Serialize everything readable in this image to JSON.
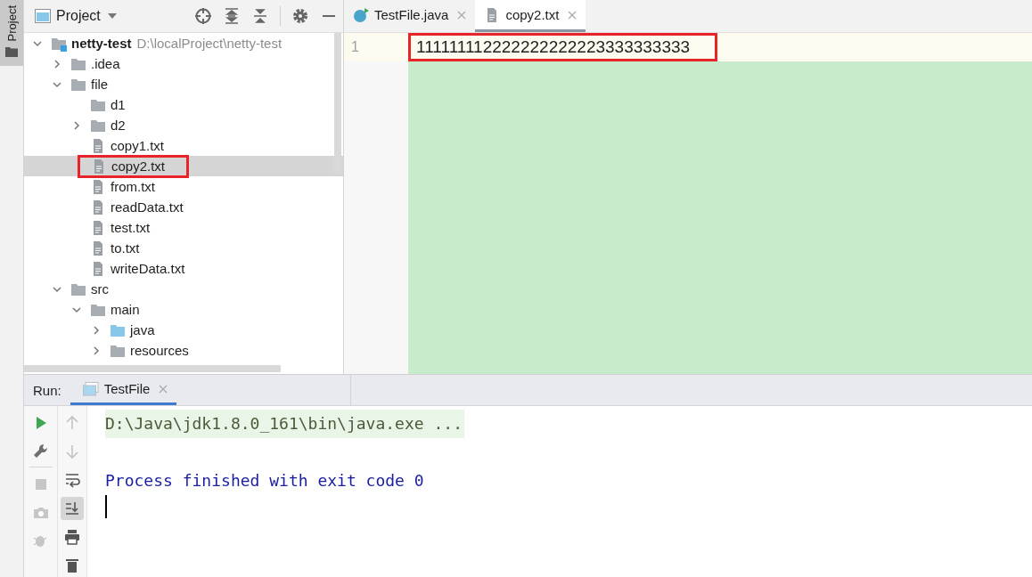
{
  "tool_strip": {
    "label": "Project",
    "selected": true
  },
  "project_panel": {
    "title": "Project"
  },
  "tree": [
    {
      "kind": "project",
      "name": "netty-test",
      "path": "D:\\localProject\\netty-test",
      "expanded": true,
      "selected": false,
      "annotated": false,
      "children": [
        {
          "kind": "folder",
          "name": ".idea",
          "expanded": false,
          "selected": false,
          "annotated": false
        },
        {
          "kind": "folder",
          "name": "file",
          "expanded": true,
          "selected": false,
          "annotated": false,
          "children": [
            {
              "kind": "folder",
              "name": "d1",
              "selected": false,
              "annotated": false
            },
            {
              "kind": "folder",
              "name": "d2",
              "expanded": false,
              "selected": false,
              "annotated": false
            },
            {
              "kind": "file",
              "name": "copy1.txt",
              "selected": false,
              "annotated": false
            },
            {
              "kind": "file",
              "name": "copy2.txt",
              "selected": true,
              "annotated": true
            },
            {
              "kind": "file",
              "name": "from.txt",
              "selected": false,
              "annotated": false
            },
            {
              "kind": "file",
              "name": "readData.txt",
              "selected": false,
              "annotated": false
            },
            {
              "kind": "file",
              "name": "test.txt",
              "selected": false,
              "annotated": false
            },
            {
              "kind": "file",
              "name": "to.txt",
              "selected": false,
              "annotated": false
            },
            {
              "kind": "file",
              "name": "writeData.txt",
              "selected": false,
              "annotated": false
            }
          ]
        },
        {
          "kind": "folder",
          "name": "src",
          "expanded": true,
          "selected": false,
          "annotated": false,
          "children": [
            {
              "kind": "folder",
              "name": "main",
              "expanded": true,
              "selected": false,
              "annotated": false,
              "children": [
                {
                  "kind": "source",
                  "name": "java",
                  "expanded": false,
                  "selected": false,
                  "annotated": false
                },
                {
                  "kind": "folder",
                  "name": "resources",
                  "expanded": false,
                  "selected": false,
                  "annotated": false
                }
              ]
            }
          ]
        }
      ]
    }
  ],
  "editor_tabs": [
    {
      "kind": "java",
      "label": "TestFile.java",
      "selected": false
    },
    {
      "kind": "text",
      "label": "copy2.txt",
      "selected": true
    }
  ],
  "editor": {
    "lines": [
      {
        "number": "1",
        "text": "111111112222222222223333333333",
        "annotated": true
      }
    ]
  },
  "run_panel": {
    "label": "Run:",
    "tabs": [
      {
        "label": "TestFile",
        "selected": true
      }
    ]
  },
  "run_toolbar": [
    {
      "kind": "run",
      "disabled": false
    },
    {
      "kind": "wrench",
      "disabled": false
    },
    {
      "kind": "stop",
      "disabled": true
    },
    {
      "kind": "camera",
      "disabled": true
    },
    {
      "kind": "bug",
      "disabled": true
    }
  ],
  "console_toolbar": [
    {
      "kind": "up",
      "disabled": true,
      "on": false
    },
    {
      "kind": "down",
      "disabled": true,
      "on": false
    },
    {
      "kind": "wrap",
      "disabled": false,
      "on": false
    },
    {
      "kind": "scroll-end",
      "disabled": false,
      "on": true
    },
    {
      "kind": "print",
      "disabled": false,
      "on": false
    },
    {
      "kind": "trash",
      "disabled": false,
      "on": false
    }
  ],
  "console": [
    {
      "kind": "command",
      "text": "D:\\Java\\jdk1.8.0_161\\bin\\java.exe ..."
    },
    {
      "kind": "info",
      "text": "Process finished with exit code 0"
    }
  ]
}
